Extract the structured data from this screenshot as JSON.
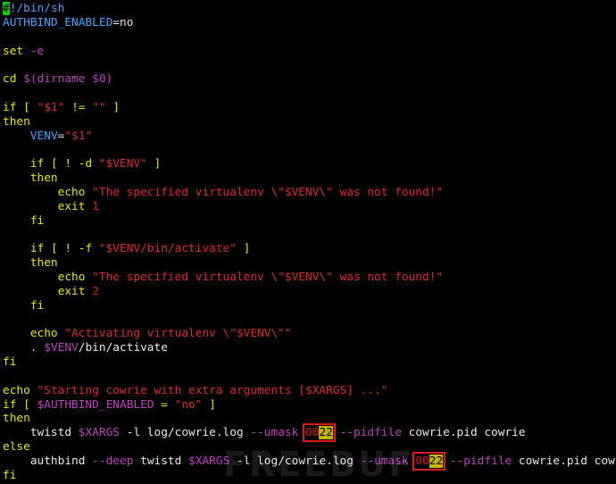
{
  "colors": {
    "background": "#000000",
    "default": "#e8e8e8",
    "keyword": "#e8e800",
    "variable": "#c040c0",
    "string": "#dd2a2a",
    "number": "#e01a1a",
    "shebang": "#3fa7ff",
    "option": "#c040c0",
    "highlight_bg": "#c8b400",
    "box_border": "#e01818",
    "cursor_bg": "#00d000"
  },
  "watermark": "FREEBUF",
  "script": [
    [
      [
        "#",
        "cursor"
      ],
      [
        "!/bin/sh",
        "shebang"
      ]
    ],
    [
      [
        "AUTHBIND_ENABLED",
        "shebang"
      ],
      [
        "=no",
        "default"
      ]
    ],
    [],
    [
      [
        "set ",
        "keyword"
      ],
      [
        "-e",
        "variable"
      ]
    ],
    [],
    [
      [
        "cd ",
        "keyword"
      ],
      [
        "$(dirname $0)",
        "variable"
      ]
    ],
    [],
    [
      [
        "if [ ",
        "keyword"
      ],
      [
        "\"$1\"",
        "string"
      ],
      [
        " != ",
        "keyword"
      ],
      [
        "\"\"",
        "string"
      ],
      [
        " ]",
        "keyword"
      ]
    ],
    [
      [
        "then",
        "keyword"
      ]
    ],
    [
      [
        "    ",
        "default"
      ],
      [
        "VENV",
        "shebang"
      ],
      [
        "=",
        "default"
      ],
      [
        "\"$1\"",
        "string"
      ]
    ],
    [],
    [
      [
        "    ",
        "default"
      ],
      [
        "if [ ! -d ",
        "keyword"
      ],
      [
        "\"$VENV\"",
        "string"
      ],
      [
        " ]",
        "keyword"
      ]
    ],
    [
      [
        "    then",
        "keyword"
      ]
    ],
    [
      [
        "        echo ",
        "keyword"
      ],
      [
        "\"The specified virtualenv \\\"$VENV\\\" was not found!\"",
        "string"
      ]
    ],
    [
      [
        "        exit ",
        "keyword"
      ],
      [
        "1",
        "number"
      ]
    ],
    [
      [
        "    fi",
        "keyword"
      ]
    ],
    [],
    [
      [
        "    ",
        "default"
      ],
      [
        "if [ ! -f ",
        "keyword"
      ],
      [
        "\"$VENV/bin/activate\"",
        "string"
      ],
      [
        " ]",
        "keyword"
      ]
    ],
    [
      [
        "    then",
        "keyword"
      ]
    ],
    [
      [
        "        echo ",
        "keyword"
      ],
      [
        "\"The specified virtualenv \\\"$VENV\\\" was not found!\"",
        "string"
      ]
    ],
    [
      [
        "        exit ",
        "keyword"
      ],
      [
        "2",
        "number"
      ]
    ],
    [
      [
        "    fi",
        "keyword"
      ]
    ],
    [],
    [
      [
        "    echo ",
        "keyword"
      ],
      [
        "\"Activating virtualenv \\\"$VENV\\\"\"",
        "string"
      ]
    ],
    [
      [
        "    . ",
        "keyword"
      ],
      [
        "$VENV",
        "variable"
      ],
      [
        "/bin/activate",
        "default"
      ]
    ],
    [
      [
        "fi",
        "keyword"
      ]
    ],
    [],
    [
      [
        "echo ",
        "keyword"
      ],
      [
        "\"Starting cowrie with extra arguments [$XARGS] ...\"",
        "string"
      ]
    ],
    [
      [
        "if [ ",
        "keyword"
      ],
      [
        "$AUTHBIND_ENABLED",
        "variable"
      ],
      [
        " = ",
        "keyword"
      ],
      [
        "\"no\"",
        "string"
      ],
      [
        " ]",
        "keyword"
      ]
    ],
    [
      [
        "then",
        "keyword"
      ]
    ],
    [
      [
        "    twistd ",
        "default"
      ],
      [
        "$XARGS",
        "variable"
      ],
      [
        " -l log/cowrie.log ",
        "default"
      ],
      [
        "--umask ",
        "option"
      ],
      [
        "00",
        "box-num"
      ],
      [
        "22",
        "box-hl"
      ],
      [
        " --pidfile ",
        "option"
      ],
      [
        "cowrie.pid cowrie",
        "default"
      ]
    ],
    [
      [
        "else",
        "keyword"
      ]
    ],
    [
      [
        "    authbind ",
        "default"
      ],
      [
        "--deep",
        "option"
      ],
      [
        " twistd ",
        "default"
      ],
      [
        "$XARGS",
        "variable"
      ],
      [
        " -l log/cowrie.log ",
        "default"
      ],
      [
        "--umask ",
        "option"
      ],
      [
        "00",
        "box-num"
      ],
      [
        "22",
        "box-hl"
      ],
      [
        " --pidfile ",
        "option"
      ],
      [
        "cowrie.pid cowrie",
        "default"
      ]
    ],
    [
      [
        "fi",
        "keyword"
      ]
    ]
  ]
}
